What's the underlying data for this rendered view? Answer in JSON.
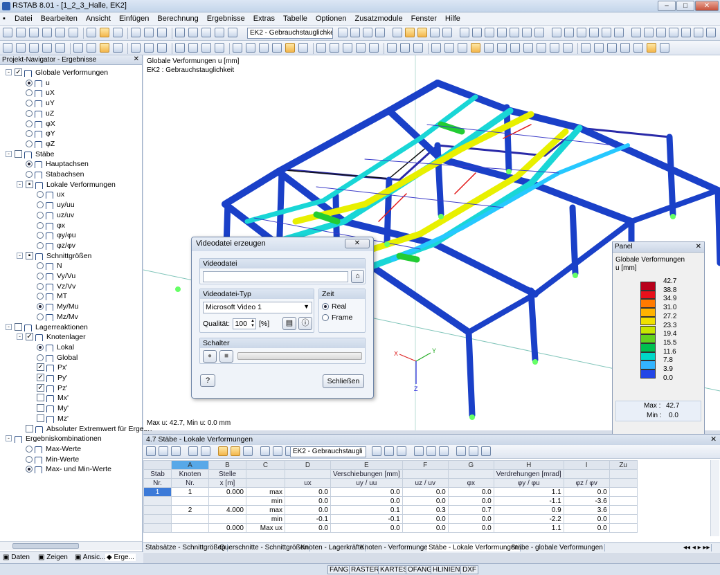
{
  "app": {
    "title": "RSTAB 8.01 - [1_2_3_Halle, EK2]"
  },
  "menu": [
    "Datei",
    "Bearbeiten",
    "Ansicht",
    "Einfügen",
    "Berechnung",
    "Ergebnisse",
    "Extras",
    "Tabelle",
    "Optionen",
    "Zusatzmodule",
    "Fenster",
    "Hilfe"
  ],
  "toolbar": {
    "loadcase_combo": "EK2 - Gebrauchstauglichke"
  },
  "navigator": {
    "title": "Projekt-Navigator - Ergebnisse",
    "items": [
      {
        "label": "Globale Verformungen",
        "level": 0,
        "exp": "-",
        "cb": "checked"
      },
      {
        "label": "u",
        "level": 1,
        "radio": true
      },
      {
        "label": "uX",
        "level": 1,
        "radio": false
      },
      {
        "label": "uY",
        "level": 1,
        "radio": false
      },
      {
        "label": "uZ",
        "level": 1,
        "radio": false
      },
      {
        "label": "φX",
        "level": 1,
        "radio": false
      },
      {
        "label": "φY",
        "level": 1,
        "radio": false
      },
      {
        "label": "φZ",
        "level": 1,
        "radio": false
      },
      {
        "label": "Stäbe",
        "level": 0,
        "exp": "-",
        "cb": "empty"
      },
      {
        "label": "Hauptachsen",
        "level": 1,
        "radio": true
      },
      {
        "label": "Stabachsen",
        "level": 1,
        "radio": false
      },
      {
        "label": "Lokale Verformungen",
        "level": 1,
        "exp": "-",
        "cb": "partial"
      },
      {
        "label": "ux",
        "level": 2,
        "radio": false
      },
      {
        "label": "uy/uu",
        "level": 2,
        "radio": false
      },
      {
        "label": "uz/uv",
        "level": 2,
        "radio": false
      },
      {
        "label": "φx",
        "level": 2,
        "radio": false
      },
      {
        "label": "φy/φu",
        "level": 2,
        "radio": false
      },
      {
        "label": "φz/φv",
        "level": 2,
        "radio": false
      },
      {
        "label": "Schnittgrößen",
        "level": 1,
        "exp": "-",
        "cb": "partial"
      },
      {
        "label": "N",
        "level": 2,
        "radio": false
      },
      {
        "label": "Vy/Vu",
        "level": 2,
        "radio": false
      },
      {
        "label": "Vz/Vv",
        "level": 2,
        "radio": false
      },
      {
        "label": "MT",
        "level": 2,
        "radio": false
      },
      {
        "label": "My/Mu",
        "level": 2,
        "radio": true
      },
      {
        "label": "Mz/Mv",
        "level": 2,
        "radio": false
      },
      {
        "label": "Lagerreaktionen",
        "level": 0,
        "exp": "-",
        "cb": "empty"
      },
      {
        "label": "Knotenlager",
        "level": 1,
        "exp": "-",
        "cb": "checked"
      },
      {
        "label": "Lokal",
        "level": 2,
        "radio": true
      },
      {
        "label": "Global",
        "level": 2,
        "radio": false
      },
      {
        "label": "Px'",
        "level": 2,
        "cb": "checked"
      },
      {
        "label": "Py'",
        "level": 2,
        "cb": "checked"
      },
      {
        "label": "Pz'",
        "level": 2,
        "cb": "checked"
      },
      {
        "label": "Mx'",
        "level": 2,
        "cb": "empty"
      },
      {
        "label": "My'",
        "level": 2,
        "cb": "empty"
      },
      {
        "label": "Mz'",
        "level": 2,
        "cb": "empty"
      },
      {
        "label": "Absoluter Extremwert für Ergebn",
        "level": 1,
        "cb": "empty"
      },
      {
        "label": "Ergebniskombinationen",
        "level": 0,
        "exp": "-",
        "cb": "none"
      },
      {
        "label": "Max-Werte",
        "level": 1,
        "radio": false
      },
      {
        "label": "Min-Werte",
        "level": 1,
        "radio": false
      },
      {
        "label": "Max- und Min-Werte",
        "level": 1,
        "radio": true
      }
    ],
    "tabs": [
      "Daten",
      "Zeigen",
      "Ansic...",
      "Erge..."
    ]
  },
  "view": {
    "line1": "Globale Verformungen u [mm]",
    "line2": "EK2 : Gebrauchstauglichkeit",
    "footer": "Max u: 42.7, Min u: 0.0 mm",
    "axis_x": "X",
    "axis_y": "Y",
    "axis_z": "Z"
  },
  "panel": {
    "title": "Panel",
    "heading1": "Globale Verformungen",
    "heading2": "u [mm]",
    "scale": [
      {
        "v": "42.7",
        "c": "#b8001b"
      },
      {
        "v": "38.8",
        "c": "#e8101b"
      },
      {
        "v": "34.9",
        "c": "#ff7a00"
      },
      {
        "v": "31.0",
        "c": "#ffb300"
      },
      {
        "v": "27.2",
        "c": "#f0e000"
      },
      {
        "v": "23.3",
        "c": "#c8e600"
      },
      {
        "v": "19.4",
        "c": "#62d21e"
      },
      {
        "v": "15.5",
        "c": "#00c050"
      },
      {
        "v": "11.6",
        "c": "#00d7c8"
      },
      {
        "v": "7.8",
        "c": "#33b4ff"
      },
      {
        "v": "3.9",
        "c": "#2346e6"
      },
      {
        "v": "0.0",
        "c": "#0a0aa0"
      }
    ],
    "max_label": "Max :",
    "max_val": "42.7",
    "min_label": "Min :",
    "min_val": "0.0"
  },
  "dialog": {
    "title": "Videodatei erzeugen",
    "group_file": "Videodatei",
    "group_type": "Videodatei-Typ",
    "type_value": "Microsoft Video 1",
    "quality_label": "Qualität:",
    "quality_value": "100",
    "quality_unit": "[%]",
    "group_time": "Zeit",
    "time_real": "Real",
    "time_frame": "Frame",
    "group_switch": "Schalter",
    "close": "Schließen"
  },
  "table": {
    "title": "4.7 Stäbe - Lokale Verformungen",
    "combo": "EK2 - Gebrauchstaugli",
    "letters": [
      "",
      "A",
      "B",
      "C",
      "D",
      "E",
      "F",
      "G",
      "H",
      "I",
      "Zu"
    ],
    "hdr_row1": [
      "Stab",
      "Knoten",
      "Stelle",
      "",
      "",
      "Verschiebungen [mm]",
      "",
      "",
      "Verdrehungen [mrad]",
      "",
      ""
    ],
    "hdr_row2": [
      "Nr.",
      "Nr.",
      "x [m]",
      "",
      "ux",
      "uy / uu",
      "uz / uv",
      "φx",
      "φy / φu",
      "φz / φv",
      ""
    ],
    "rows": [
      [
        "1",
        "1",
        "0.000",
        "max",
        "0.0",
        "0.0",
        "0.0",
        "0.0",
        "1.1",
        "0.0",
        ""
      ],
      [
        "",
        "",
        "",
        "min",
        "0.0",
        "0.0",
        "0.0",
        "0.0",
        "-1.1",
        "-3.6",
        ""
      ],
      [
        "",
        "2",
        "4.000",
        "max",
        "0.0",
        "0.1",
        "0.3",
        "0.7",
        "0.9",
        "3.6",
        ""
      ],
      [
        "",
        "",
        "",
        "min",
        "-0.1",
        "-0.1",
        "0.0",
        "0.0",
        "-2.2",
        "0.0",
        ""
      ],
      [
        "",
        "",
        "0.000",
        "Max ux",
        "0.0",
        "0.0",
        "0.0",
        "0.0",
        "1.1",
        "0.0",
        ""
      ]
    ],
    "sheet_tabs": [
      "Stabsätze - Schnittgrößen",
      "Querschnitte - Schnittgrößen",
      "Knoten - Lagerkräfte",
      "Knoten - Verformungen",
      "Stäbe - Lokale Verformungen",
      "Stäbe - globale Verformungen"
    ]
  },
  "status": [
    "FANG",
    "RASTER",
    "KARTES",
    "OFANG",
    "HLINIEN",
    "DXF"
  ]
}
